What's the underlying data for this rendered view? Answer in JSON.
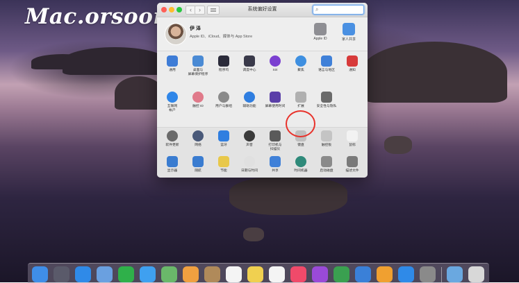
{
  "watermark": "Mac.orsoon.com",
  "window": {
    "title": "系统偏好设置",
    "search_placeholder": ""
  },
  "account": {
    "name": "伊 泽",
    "subtitle": "Apple ID、iCloud、媒体与 App Store",
    "top_icons": [
      {
        "label": "Apple ID",
        "icon": "apple-logo-icon",
        "color": "#8e8e93"
      },
      {
        "label": "家人共享",
        "icon": "cloud-icon",
        "color": "#4a90e2"
      }
    ]
  },
  "rows": [
    [
      {
        "label": "通用",
        "icon": "general-icon",
        "color": "#3e7cd6"
      },
      {
        "label": "桌面与\n屏幕保护程序",
        "icon": "desktop-icon",
        "color": "#4a8ad4"
      },
      {
        "label": "程序坞",
        "icon": "dock-icon",
        "color": "#2b2b3a"
      },
      {
        "label": "调度中心",
        "icon": "mission-control-icon",
        "color": "#3a3a4a"
      },
      {
        "label": "Siri",
        "icon": "siri-icon",
        "color": "#7a3fd0"
      },
      {
        "label": "聚焦",
        "icon": "spotlight-icon",
        "color": "#3e8fe0"
      },
      {
        "label": "语言与地区",
        "icon": "language-icon",
        "color": "#3f80d8"
      },
      {
        "label": "通知",
        "icon": "notifications-icon",
        "color": "#d73a3a"
      }
    ],
    [
      {
        "label": "互联网\n帐户",
        "icon": "internet-accounts-icon",
        "color": "#2f86e8"
      },
      {
        "label": "触控 ID",
        "icon": "touch-id-icon",
        "color": "#e07a8a"
      },
      {
        "label": "用户与群组",
        "icon": "users-icon",
        "color": "#8a8a8a"
      },
      {
        "label": "辅助功能",
        "icon": "accessibility-icon",
        "color": "#2f7ee0"
      },
      {
        "label": "屏幕使用时间",
        "icon": "screen-time-icon",
        "color": "#5a3fa8"
      },
      {
        "label": "扩展",
        "icon": "extensions-icon",
        "color": "#b0b0b0"
      },
      {
        "label": "安全性与隐私",
        "icon": "security-icon",
        "color": "#6a6a6a"
      }
    ],
    [
      {
        "label": "软件更新",
        "icon": "software-update-icon",
        "color": "#6a6a6a"
      },
      {
        "label": "网络",
        "icon": "network-icon",
        "color": "#4a5a7a"
      },
      {
        "label": "蓝牙",
        "icon": "bluetooth-icon",
        "color": "#2f7ee0"
      },
      {
        "label": "声音",
        "icon": "sound-icon",
        "color": "#3a3a3a"
      },
      {
        "label": "打印机与\n扫描仪",
        "icon": "printer-icon",
        "color": "#5a5a5a"
      },
      {
        "label": "键盘",
        "icon": "keyboard-icon",
        "color": "#bfbfbf"
      },
      {
        "label": "触控板",
        "icon": "trackpad-icon",
        "color": "#c4c4c4"
      },
      {
        "label": "鼠标",
        "icon": "mouse-icon",
        "color": "#f2f2f2"
      }
    ],
    [
      {
        "label": "显示器",
        "icon": "displays-icon",
        "color": "#3a7cd0"
      },
      {
        "label": "随航",
        "icon": "sidecar-icon",
        "color": "#3a7cd0"
      },
      {
        "label": "节能",
        "icon": "energy-saver-icon",
        "color": "#e8c84a"
      },
      {
        "label": "日期与时间",
        "icon": "date-time-icon",
        "color": "#e0e0e0"
      },
      {
        "label": "共享",
        "icon": "sharing-icon",
        "color": "#3f80d8"
      },
      {
        "label": "时间机器",
        "icon": "time-machine-icon",
        "color": "#2f8a7a"
      },
      {
        "label": "启动磁盘",
        "icon": "startup-disk-icon",
        "color": "#8a8a8a"
      },
      {
        "label": "描述文件",
        "icon": "profiles-icon",
        "color": "#7a7a7a"
      }
    ]
  ],
  "dock": [
    {
      "icon": "finder-icon",
      "color": "#3f8ee8"
    },
    {
      "icon": "launchpad-icon",
      "color": "#5a5a6a"
    },
    {
      "icon": "safari-icon",
      "color": "#2f8ae8"
    },
    {
      "icon": "mail-icon",
      "color": "#6aa0e0"
    },
    {
      "icon": "facetime-icon",
      "color": "#2fb04a"
    },
    {
      "icon": "messages-icon",
      "color": "#3fa0f0"
    },
    {
      "icon": "maps-icon",
      "color": "#6ab86a"
    },
    {
      "icon": "photos-icon",
      "color": "#f0a040"
    },
    {
      "icon": "contacts-icon",
      "color": "#b08a5a"
    },
    {
      "icon": "calendar-icon",
      "color": "#f4f4f4"
    },
    {
      "icon": "notes-icon",
      "color": "#f0d050"
    },
    {
      "icon": "reminders-icon",
      "color": "#f4f4f4"
    },
    {
      "icon": "music-icon",
      "color": "#f04a6a"
    },
    {
      "icon": "podcasts-icon",
      "color": "#9a4ad8"
    },
    {
      "icon": "numbers-icon",
      "color": "#3aa050"
    },
    {
      "icon": "keynote-icon",
      "color": "#3a80d8"
    },
    {
      "icon": "pages-icon",
      "color": "#f0a030"
    },
    {
      "icon": "app-store-icon",
      "color": "#2f8ae8"
    },
    {
      "icon": "system-preferences-icon",
      "color": "#8a8a8a"
    },
    {
      "icon": "downloads-folder-icon",
      "color": "#6aa8e0"
    },
    {
      "icon": "trash-icon",
      "color": "#d8d8d8"
    }
  ]
}
